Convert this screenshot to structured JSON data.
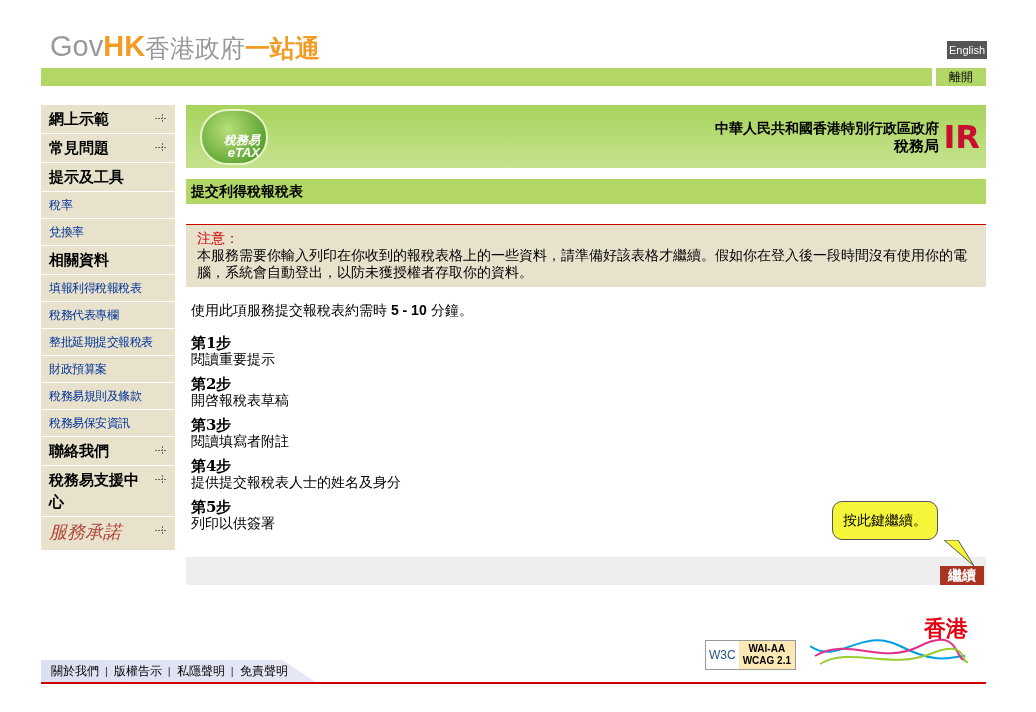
{
  "header": {
    "logo": {
      "gov": "Gov",
      "hk": "HK",
      "name": "香港政府",
      "one_stop": "一站通"
    },
    "language_button": "English",
    "logout_button": "離開"
  },
  "sidebar": {
    "items": [
      {
        "kind": "heading",
        "label": "網上示範",
        "expandable": true
      },
      {
        "kind": "heading",
        "label": "常見問題",
        "expandable": true
      },
      {
        "kind": "heading",
        "label": "提示及工具",
        "expandable": false
      },
      {
        "kind": "link",
        "label": "稅率"
      },
      {
        "kind": "link",
        "label": "兌換率"
      },
      {
        "kind": "heading",
        "label": "相關資料",
        "expandable": false
      },
      {
        "kind": "link",
        "label": "填報利得稅報稅表"
      },
      {
        "kind": "link",
        "label": "稅務代表專欄"
      },
      {
        "kind": "link",
        "label": "整批延期提交報稅表"
      },
      {
        "kind": "link",
        "label": "財政預算案"
      },
      {
        "kind": "link",
        "label": "稅務易規則及條款"
      },
      {
        "kind": "link",
        "label": "稅務易保安資訊"
      },
      {
        "kind": "heading",
        "label": "聯絡我們",
        "expandable": true
      },
      {
        "kind": "heading",
        "label": "稅務易支援中心",
        "expandable": true
      },
      {
        "kind": "logo",
        "label": "服務承諾",
        "expandable": true
      }
    ]
  },
  "banner": {
    "etax_logo": {
      "chinese": "稅務易",
      "english": "eTAX"
    },
    "government": "中華人民共和國香港特別行政區政府",
    "department": "稅務局",
    "ir_logo": "IR"
  },
  "page_title": "提交利得稅報稅表",
  "notice": {
    "title": "注意：",
    "body": "本服務需要你輸入列印在你收到的報稅表格上的一些資料，請準備好該表格才繼續。假如你在登入後一段時間沒有使用你的電腦，系統會自動登出，以防未獲授權者存取你的資料。"
  },
  "duration": "使用此項服務提交報稅表約需時 **5 - 10** 分鐘。",
  "steps": [
    {
      "label": "第1步",
      "text": "閱讀重要提示"
    },
    {
      "label": "第2步",
      "text": "開啓報稅表草稿"
    },
    {
      "label": "第3步",
      "text": "閱讀填寫者附註"
    },
    {
      "label": "第4步",
      "text": "提供提交報稅表人士的姓名及身分"
    },
    {
      "label": "第5步",
      "text": "列印以供簽署"
    }
  ],
  "tooltip": "按此鍵繼續。",
  "continue_button": "繼續",
  "footer": {
    "links": [
      "關於我們",
      "版權告示",
      "私隱聲明",
      "免責聲明"
    ],
    "separator": "|",
    "w3c_badge": {
      "w3c": "W3C",
      "level": "WAI-AA",
      "standard": "WCAG 2.1"
    },
    "brand_hk": "香港"
  }
}
